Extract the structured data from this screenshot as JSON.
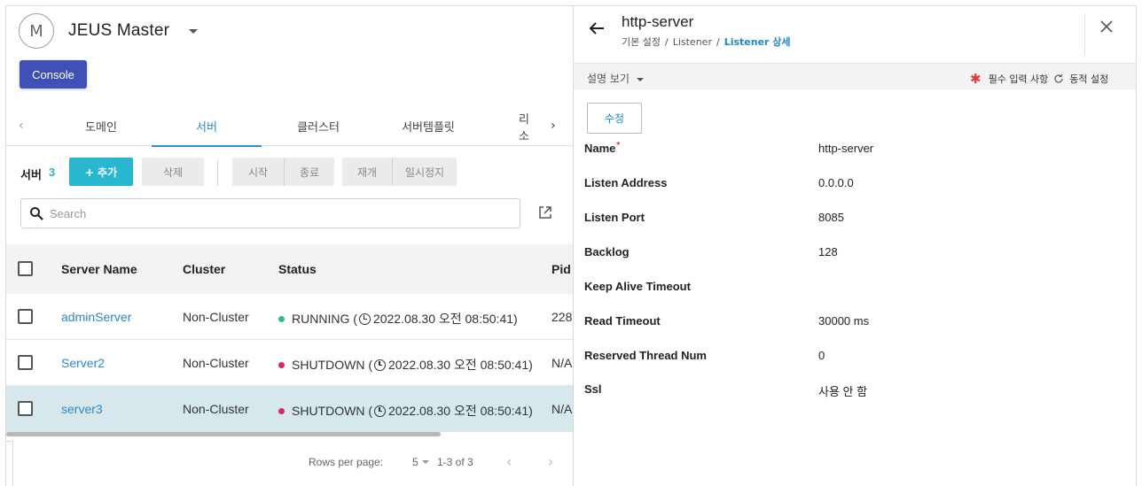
{
  "header": {
    "avatar_letter": "M",
    "app_title": "JEUS Master",
    "console_label": "Console"
  },
  "tabs": [
    {
      "label": "도메인",
      "active": false
    },
    {
      "label": "서버",
      "active": true
    },
    {
      "label": "클러스터",
      "active": false
    },
    {
      "label": "서버템플릿",
      "active": false
    },
    {
      "label": "리소",
      "active": false
    }
  ],
  "toolbar": {
    "title": "서버",
    "count": "3",
    "add_label": "+ 추가",
    "delete_label": "삭제",
    "start_label": "시작",
    "stop_label": "종료",
    "resume_label": "재개",
    "suspend_label": "일시정지"
  },
  "search": {
    "placeholder": "Search",
    "value": ""
  },
  "table": {
    "columns": [
      "Server Name",
      "Cluster",
      "Status",
      "Pid"
    ],
    "rows": [
      {
        "name": "adminServer",
        "cluster": "Non-Cluster",
        "status": "RUNNING",
        "time": "2022.08.30 오전 08:50:41",
        "pid": "228",
        "status_color": "#26c281",
        "selected": false
      },
      {
        "name": "Server2",
        "cluster": "Non-Cluster",
        "status": "SHUTDOWN",
        "time": "2022.08.30 오전 08:50:41",
        "pid": "N/A",
        "status_color": "#e0245e",
        "selected": false
      },
      {
        "name": "server3",
        "cluster": "Non-Cluster",
        "status": "SHUTDOWN",
        "time": "2022.08.30 오전 08:50:41",
        "pid": "N/A",
        "status_color": "#e0245e",
        "selected": true
      }
    ]
  },
  "pagination": {
    "rows_label": "Rows per page:",
    "rows_value": "5",
    "range": "1-3 of 3"
  },
  "detail": {
    "title": "http-server",
    "breadcrumb": [
      "기본 설정",
      "Listener",
      "Listener 상세"
    ],
    "desc_toggle": "설명 보기",
    "required_label": "필수 입력 사항",
    "dynamic_label": "동적 설정",
    "edit_label": "수정",
    "properties": [
      {
        "label": "Name",
        "value": "http-server",
        "required": true
      },
      {
        "label": "Listen Address",
        "value": "0.0.0.0",
        "required": false
      },
      {
        "label": "Listen Port",
        "value": "8085",
        "required": false
      },
      {
        "label": "Backlog",
        "value": "128",
        "required": false
      },
      {
        "label": "Keep Alive Timeout",
        "value": "",
        "required": false
      },
      {
        "label": "Read Timeout",
        "value": "30000 ms",
        "required": false
      },
      {
        "label": "Reserved Thread Num",
        "value": "0",
        "required": false
      },
      {
        "label": "Ssl",
        "value": "사용 안 함",
        "required": false
      }
    ]
  },
  "colors": {
    "brand": "#3f51b5",
    "accent": "#29b6d1",
    "link": "#2f86c5",
    "selected_row": "#d7e8ed",
    "running": "#26c281",
    "shutdown": "#e0245e"
  }
}
